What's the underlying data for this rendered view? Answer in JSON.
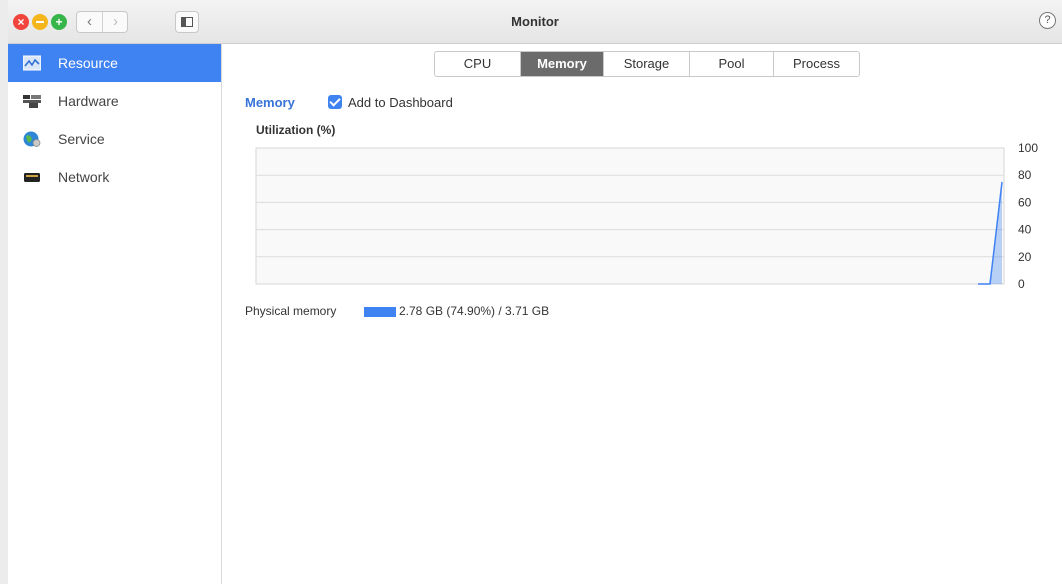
{
  "window": {
    "title": "Monitor",
    "help": "?"
  },
  "sidebar": {
    "items": [
      {
        "label": "Resource",
        "icon": "resource-chart-icon",
        "active": true
      },
      {
        "label": "Hardware",
        "icon": "hardware-icon",
        "active": false
      },
      {
        "label": "Service",
        "icon": "service-globe-icon",
        "active": false
      },
      {
        "label": "Network",
        "icon": "network-icon",
        "active": false
      }
    ]
  },
  "tabs": [
    {
      "label": "CPU",
      "active": false
    },
    {
      "label": "Memory",
      "active": true
    },
    {
      "label": "Storage",
      "active": false
    },
    {
      "label": "Pool",
      "active": false
    },
    {
      "label": "Process",
      "active": false
    }
  ],
  "section": {
    "title": "Memory",
    "add_to_dashboard": "Add to Dashboard",
    "checked": true
  },
  "colors": {
    "accent": "#3f82f2",
    "active_tab": "#6b6b6b"
  },
  "chart_data": {
    "type": "area",
    "ylabel": "Utilization (%)",
    "ylim": [
      0,
      100
    ],
    "yticks": [
      "100",
      "80",
      "60",
      "40",
      "20",
      "0"
    ],
    "grid": true,
    "series": [
      {
        "name": "Physical memory",
        "color": "#3f82f2",
        "values": [
          0,
          0,
          0,
          75
        ]
      }
    ],
    "legend": {
      "label": "Physical memory",
      "value": "2.78 GB (74.90%) / 3.71 GB"
    }
  }
}
